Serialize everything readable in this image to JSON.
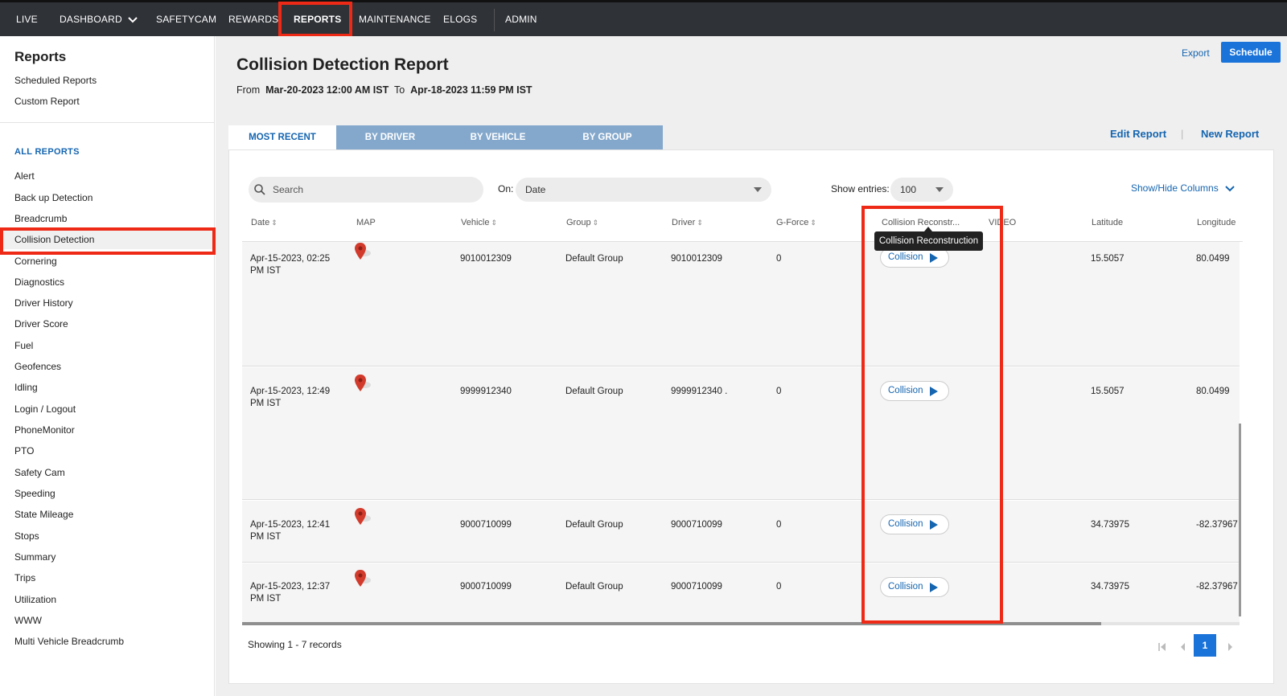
{
  "nav": {
    "items": [
      "LIVE",
      "DASHBOARD",
      "SAFETYCAM",
      "REWARDS",
      "REPORTS",
      "MAINTENANCE",
      "ELOGS",
      "ADMIN"
    ],
    "active": "REPORTS"
  },
  "sidebar": {
    "title": "Reports",
    "links": [
      "Scheduled Reports",
      "Custom Report"
    ],
    "section_label": "ALL REPORTS",
    "reports": [
      "Alert",
      "Back up Detection",
      "Breadcrumb",
      "Collision Detection",
      "Cornering",
      "Diagnostics",
      "Driver History",
      "Driver Score",
      "Fuel",
      "Geofences",
      "Idling",
      "Login / Logout",
      "PhoneMonitor",
      "PTO",
      "Safety Cam",
      "Speeding",
      "State Mileage",
      "Stops",
      "Summary",
      "Trips",
      "Utilization",
      "WWW",
      "Multi Vehicle Breadcrumb"
    ],
    "active_report": "Collision Detection"
  },
  "header": {
    "title": "Collision Detection Report",
    "from_label": "From",
    "from_value": "Mar-20-2023 12:00 AM IST",
    "to_label": "To",
    "to_value": "Apr-18-2023 11:59 PM IST",
    "export_label": "Export",
    "schedule_label": "Schedule"
  },
  "tabs": [
    "MOST RECENT",
    "BY DRIVER",
    "BY VEHICLE",
    "BY GROUP"
  ],
  "active_tab": "MOST RECENT",
  "report_actions": {
    "edit": "Edit Report",
    "separator": "|",
    "new": "New Report"
  },
  "filters": {
    "search_placeholder": "Search",
    "on_label": "On:",
    "on_value": "Date",
    "show_entries_label": "Show entries:",
    "show_entries_value": "100",
    "show_hide_label": "Show/Hide Columns"
  },
  "table": {
    "columns": [
      "Date",
      "MAP",
      "Vehicle",
      "Group",
      "Driver",
      "G-Force",
      "Collision Reconstr...",
      "VIDEO",
      "Latitude",
      "Longitude"
    ],
    "sort_icon": "⇕",
    "tooltip": "Collision Reconstruction",
    "rows": [
      {
        "date": "Apr-15-2023, 02:25",
        "date_tz": "PM IST",
        "vehicle": "9010012309",
        "group": "Default Group",
        "driver": "9010012309",
        "gforce": "0",
        "action": "Collision",
        "lat": "15.5057",
        "lng": "80.0499"
      },
      {
        "date": "Apr-15-2023, 12:49",
        "date_tz": "PM IST",
        "vehicle": "9999912340",
        "group": "Default Group",
        "driver": "9999912340 .",
        "gforce": "0",
        "action": "Collision",
        "lat": "15.5057",
        "lng": "80.0499"
      },
      {
        "date": "Apr-15-2023, 12:41",
        "date_tz": "PM IST",
        "vehicle": "9000710099",
        "group": "Default Group",
        "driver": "9000710099",
        "gforce": "0",
        "action": "Collision",
        "lat": "34.73975",
        "lng": "-82.37967"
      },
      {
        "date": "Apr-15-2023, 12:37",
        "date_tz": "PM IST",
        "vehicle": "9000710099",
        "group": "Default Group",
        "driver": "9000710099",
        "gforce": "0",
        "action": "Collision",
        "lat": "34.73975",
        "lng": "-82.37967"
      }
    ]
  },
  "footer": {
    "showing": "Showing 1 - 7 records",
    "page": "1"
  },
  "colors": {
    "nav_bg": "#2f3237",
    "accent": "#1a73d9",
    "link": "#1565b0",
    "highlight": "#ee2a17",
    "tab_inactive": "#84a8cc",
    "pin": "#d23b2c"
  },
  "icons": [
    "chevron-down-icon",
    "search-icon",
    "map-pin-icon",
    "play-icon",
    "first-page-icon",
    "prev-page-icon",
    "next-page-icon"
  ]
}
